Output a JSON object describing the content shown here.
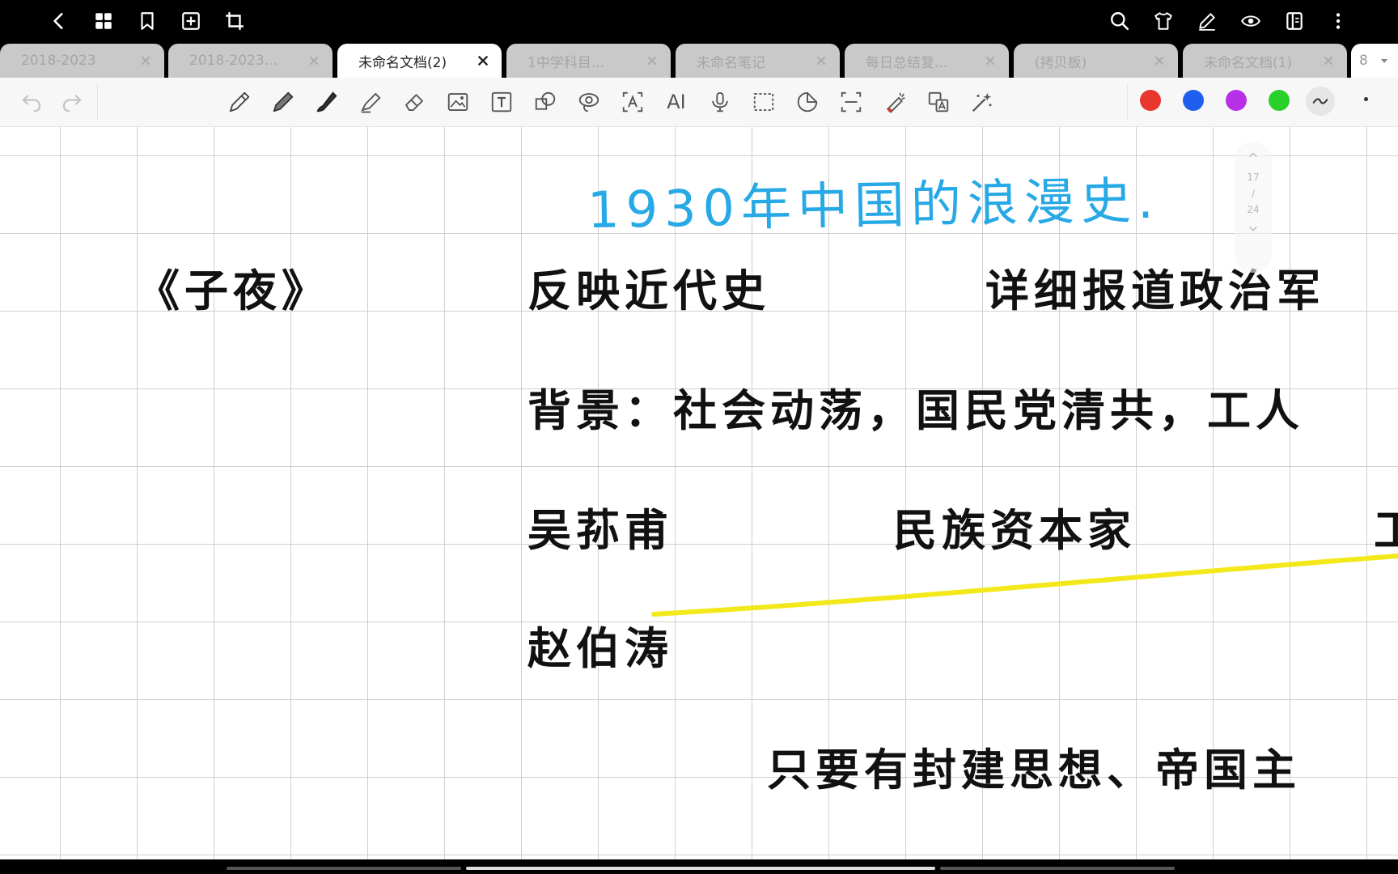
{
  "topbar": {
    "left_icons": [
      "back-icon",
      "grid-icon",
      "bookmark-icon",
      "add-page-icon",
      "crop-icon"
    ],
    "right_icons": [
      "search-icon",
      "shirt-icon",
      "pen-settings-icon",
      "eye-icon",
      "layout-icon",
      "more-icon"
    ]
  },
  "tabs": [
    {
      "label": "2018-2023",
      "active": false
    },
    {
      "label": "2018-2023...",
      "active": false
    },
    {
      "label": "未命名文档(2)",
      "active": true
    },
    {
      "label": "1中学科目...",
      "active": false
    },
    {
      "label": "未命名笔记",
      "active": false
    },
    {
      "label": "每日总结复...",
      "active": false
    },
    {
      "label": "(拷贝板)",
      "active": false
    },
    {
      "label": "未命名文档(1)",
      "active": false
    }
  ],
  "tab_count": "8",
  "toolbar": {
    "tools": [
      "undo-icon",
      "redo-icon",
      "pencil-icon",
      "pen-icon",
      "brush-icon",
      "highlighter-icon",
      "eraser-icon",
      "image-icon",
      "text-icon",
      "shape-icon",
      "lasso-icon",
      "ocr-text-icon",
      "ai-icon",
      "microphone-icon",
      "select-rect-icon",
      "sticker-icon",
      "scan-icon",
      "laser-pointer-icon",
      "translate-icon",
      "magic-icon"
    ],
    "ai_label": "AI",
    "colors": [
      "#e8372c",
      "#1f5ff0",
      "#b82fe8",
      "#2ad02a"
    ],
    "accent": "#27a9e6"
  },
  "canvas": {
    "title_handwritten": "1930年中国的浪漫史.",
    "book_title": "《子夜》",
    "line1_left": "反映近代史",
    "line1_right": "详细报道政治军",
    "line2": "背景：社会动荡，国民党清共，工人",
    "line3_left": "吴荪甫",
    "line3_mid": "民族资本家",
    "line3_right": "工",
    "line4": "赵伯涛",
    "line5": "只要有封建思想、帝国主",
    "highlight_color": "#f2e81a"
  },
  "page_scroller": {
    "current": "17",
    "separator": "/",
    "total": "24"
  }
}
